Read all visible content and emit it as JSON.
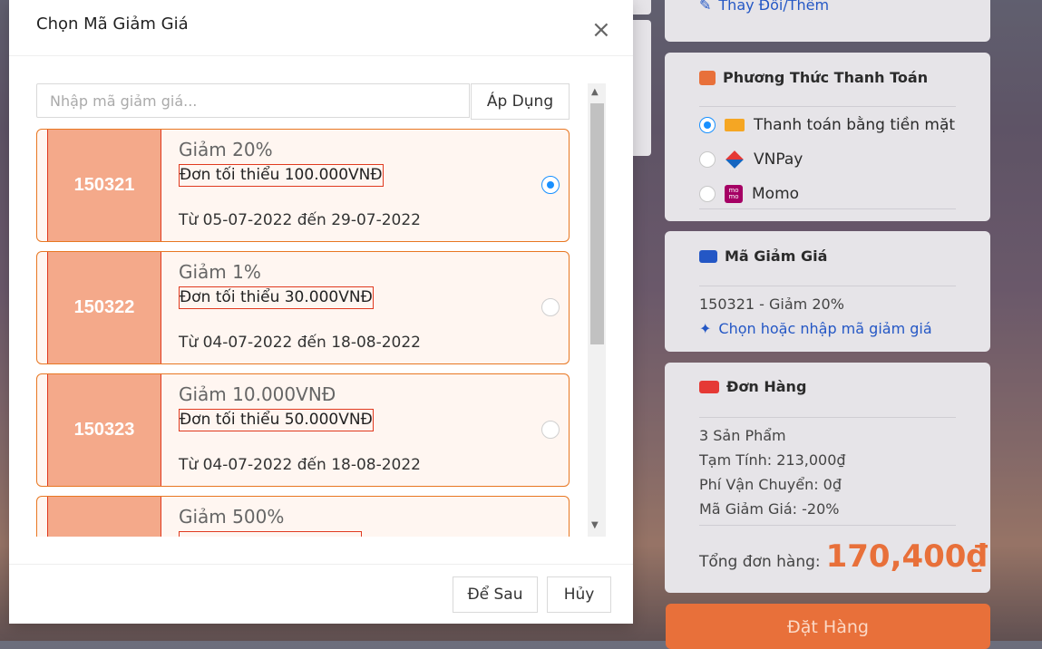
{
  "side": {
    "address_link": "Thay Đổi/Thêm",
    "payment": {
      "title": "Phương Thức Thanh Toán",
      "options": [
        {
          "label": "Thanh toán bằng tiền mặt",
          "selected": true
        },
        {
          "label": "VNPay",
          "selected": false
        },
        {
          "label": "Momo",
          "selected": false
        }
      ],
      "momo_logo_text": "mo mo"
    },
    "discount": {
      "title": "Mã Giảm Giá",
      "current": "150321 - Giảm 20%",
      "link": "Chọn hoặc nhập mã giảm giá"
    },
    "order": {
      "title": "Đơn Hàng",
      "lines": [
        "3 Sản Phẩm",
        "Tạm Tính: 213,000₫",
        "Phí Vận Chuyển: 0₫",
        "Mã Giảm Giá: -20%"
      ],
      "total_label": "Tổng đơn hàng:",
      "total_value": "170,400₫"
    },
    "place_order": "Đặt Hàng"
  },
  "modal": {
    "title": "Chọn Mã Giảm Giá",
    "close_icon": "×",
    "search_placeholder": "Nhập mã giảm giá...",
    "apply_label": "Áp Dụng",
    "coupons": [
      {
        "code": "150321",
        "title": "Giảm 20%",
        "min": "Đơn tối thiểu 100.000VNĐ",
        "dates": "Từ 05-07-2022 đến 29-07-2022",
        "selected": true
      },
      {
        "code": "150322",
        "title": "Giảm 1%",
        "min": "Đơn tối thiểu 30.000VNĐ",
        "dates": "Từ 04-07-2022 đến 18-08-2022",
        "selected": false
      },
      {
        "code": "150323",
        "title": "Giảm 10.000VNĐ",
        "min": "Đơn tối thiểu 50.000VNĐ",
        "dates": "Từ 04-07-2022 đến 18-08-2022",
        "selected": false
      },
      {
        "code": "",
        "title": "Giảm 500%",
        "min": "",
        "dates": "",
        "selected": false
      }
    ],
    "later_label": "Để Sau",
    "cancel_label": "Hủy"
  },
  "colors": {
    "accent_orange": "#e87722",
    "code_fill": "#f4a98a",
    "radio_blue": "#1890ff",
    "total_orange": "#e8703a",
    "link_blue": "#2457c5"
  }
}
